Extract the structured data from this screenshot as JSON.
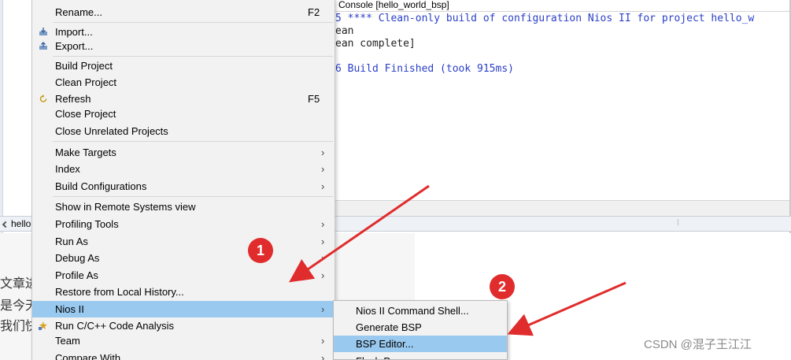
{
  "console": {
    "title": "Console [hello_world_bsp]",
    "lines": [
      "5 **** Clean-only build of configuration Nios II for project hello_w",
      "ean",
      "ean complete]",
      "6 Build Finished (took 915ms)"
    ]
  },
  "project_tab": {
    "label": "hello"
  },
  "page_text": [
    "文章进",
    "是今天",
    "我们快"
  ],
  "context_menu": {
    "items": [
      {
        "label": "Rename...",
        "accelerator": "F2"
      },
      {
        "label": "Import...",
        "icon": "import-icon"
      },
      {
        "label": "Export...",
        "icon": "export-icon"
      },
      {
        "label": "Build Project"
      },
      {
        "label": "Clean Project"
      },
      {
        "label": "Refresh",
        "accelerator": "F5",
        "icon": "refresh-icon"
      },
      {
        "label": "Close Project"
      },
      {
        "label": "Close Unrelated Projects"
      },
      {
        "label": "Make Targets",
        "submenu": "›"
      },
      {
        "label": "Index",
        "submenu": "›"
      },
      {
        "label": "Build Configurations",
        "submenu": "›"
      },
      {
        "label": "Show in Remote Systems view"
      },
      {
        "label": "Profiling Tools",
        "submenu": "›"
      },
      {
        "label": "Run As",
        "submenu": "›"
      },
      {
        "label": "Debug As",
        "submenu": "›"
      },
      {
        "label": "Profile As",
        "submenu": "›"
      },
      {
        "label": "Restore from Local History..."
      },
      {
        "label": "Nios II",
        "submenu": "›",
        "highlighted": true
      },
      {
        "label": "Run C/C++ Code Analysis",
        "icon": "code-analysis-icon"
      },
      {
        "label": "Team",
        "submenu": "›"
      },
      {
        "label": "Compare With",
        "submenu": "›"
      }
    ]
  },
  "nios_submenu": {
    "items": [
      {
        "label": "Nios II Command Shell..."
      },
      {
        "label": "Generate BSP"
      },
      {
        "label": "BSP Editor...",
        "highlighted": true
      },
      {
        "label": "Flash P..."
      }
    ]
  },
  "annotations": {
    "step1": "1",
    "step2": "2"
  },
  "watermark": "CSDN @混子王江江",
  "colors": {
    "highlight": "#99c9ef",
    "annotation_red": "#e02c2c",
    "console_blue": "#2a3fc7"
  }
}
